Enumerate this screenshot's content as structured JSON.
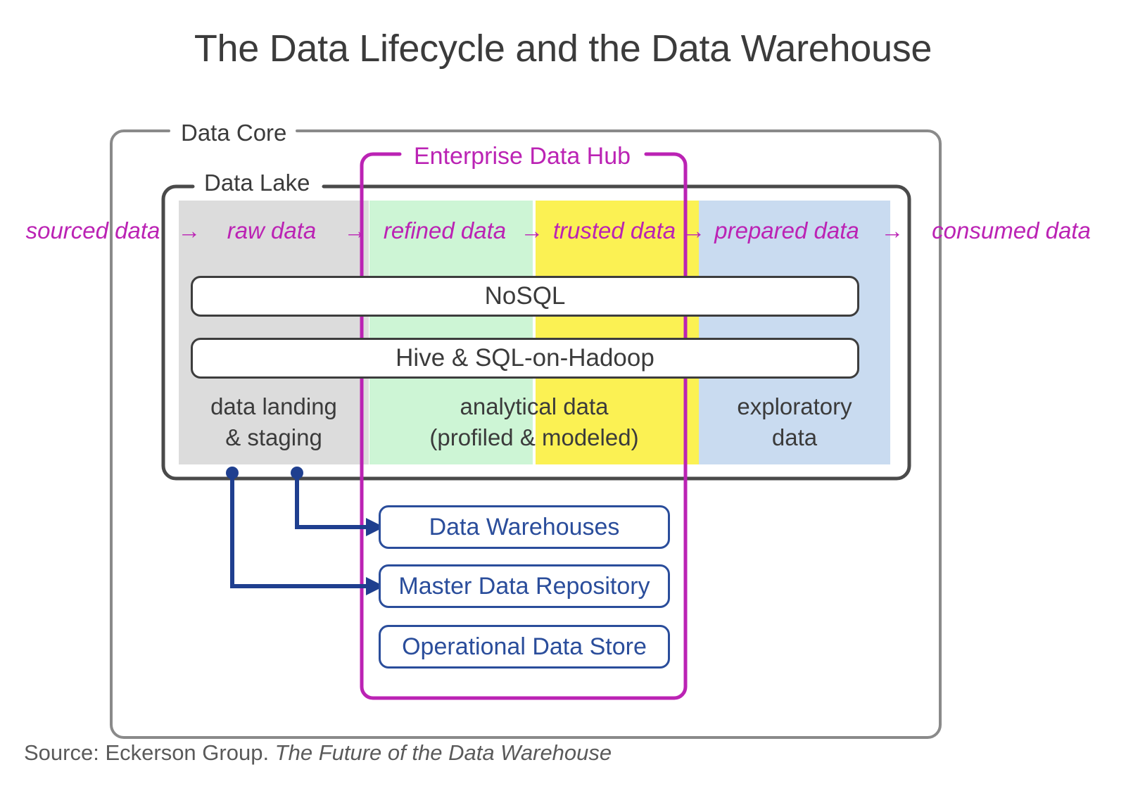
{
  "title": "The Data Lifecycle and the Data Warehouse",
  "colors": {
    "magenta": "#bb23b4",
    "navy": "#2a4d9b",
    "gray_outline": "#8a8a8a",
    "dark_outline": "#3d3d3d",
    "zone_gray": "#dcdcdc",
    "zone_green": "#cdf5d5",
    "zone_yellow": "#fbf153",
    "zone_blue": "#c9dbf0"
  },
  "containers": {
    "data_core": "Data Core",
    "data_lake": "Data Lake",
    "enterprise_data_hub": "Enterprise Data Hub"
  },
  "lifecycle": {
    "arrow": "→",
    "stages": [
      {
        "label": "sourced data"
      },
      {
        "label": "raw data"
      },
      {
        "label": "refined data"
      },
      {
        "label": "trusted data"
      },
      {
        "label": "prepared data"
      },
      {
        "label": "consumed data"
      }
    ]
  },
  "zones": [
    {
      "id": "gray",
      "caption_line1": "data landing",
      "caption_line2": "& staging",
      "color": "#dcdcdc"
    },
    {
      "id": "green",
      "caption_line1": "analytical data",
      "caption_line2": "(profiled & modeled)",
      "color": "#cdf5d5"
    },
    {
      "id": "yellow",
      "caption_line1": "",
      "caption_line2": "",
      "color": "#fbf153"
    },
    {
      "id": "blue",
      "caption_line1": "exploratory",
      "caption_line2": "data",
      "color": "#c9dbf0"
    }
  ],
  "engines": [
    {
      "label": "NoSQL"
    },
    {
      "label": "Hive & SQL-on-Hadoop"
    }
  ],
  "repositories": [
    {
      "label": "Data Warehouses"
    },
    {
      "label": "Master Data Repository"
    },
    {
      "label": "Operational Data Store"
    }
  ],
  "source": {
    "prefix": "Source: Eckerson Group. ",
    "publication": "The Future of the Data Warehouse"
  }
}
